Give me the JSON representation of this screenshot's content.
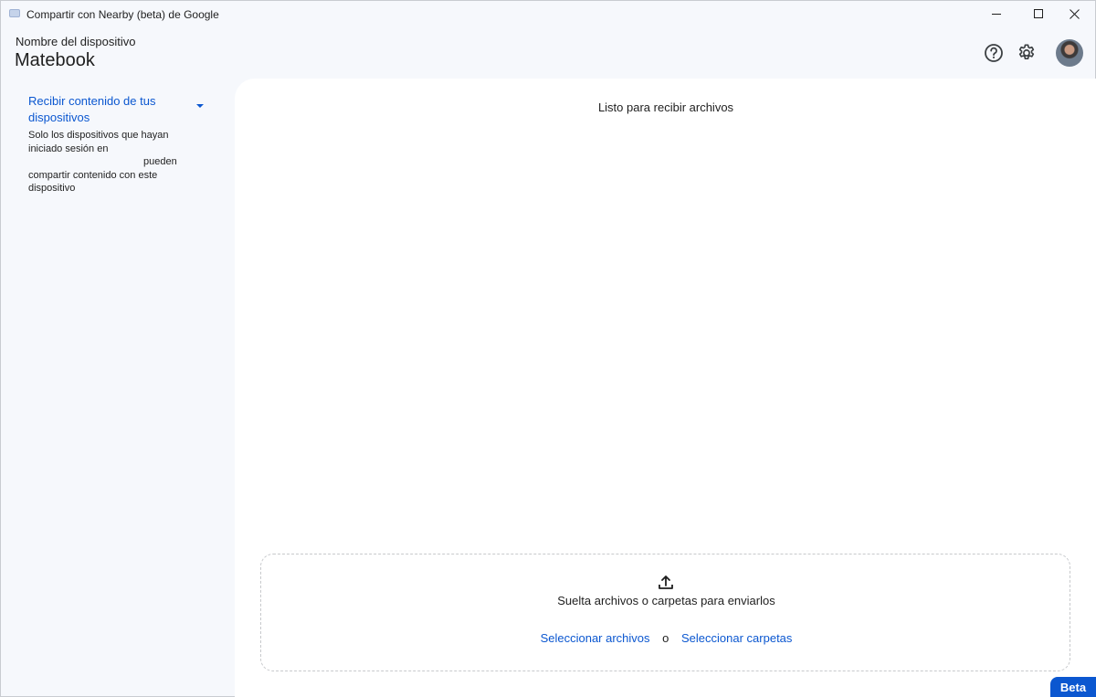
{
  "window": {
    "title": "Compartir con Nearby (beta) de Google",
    "controls": {
      "minimize": "minimize-icon",
      "maximize": "maximize-icon",
      "close": "close-icon"
    }
  },
  "header": {
    "device_label": "Nombre del dispositivo",
    "device_name": "Matebook",
    "icons": [
      "help-icon",
      "gear-icon",
      "avatar"
    ]
  },
  "sidebar": {
    "title": "Recibir contenido de tus dispositivos",
    "description_lines": [
      "Solo los dispositivos que hayan",
      "iniciado sesión en",
      "pueden",
      "compartir contenido con este",
      "dispositivo"
    ]
  },
  "main": {
    "status": "Listo para recibir archivos",
    "dropzone": {
      "text": "Suelta archivos o carpetas para enviarlos",
      "select_files": "Seleccionar archivos",
      "or": "o",
      "select_folders": "Seleccionar carpetas"
    }
  },
  "badge": {
    "label": "Beta"
  },
  "colors": {
    "accent": "#0b57d0",
    "background": "#f6f8fc",
    "panel": "#ffffff"
  }
}
